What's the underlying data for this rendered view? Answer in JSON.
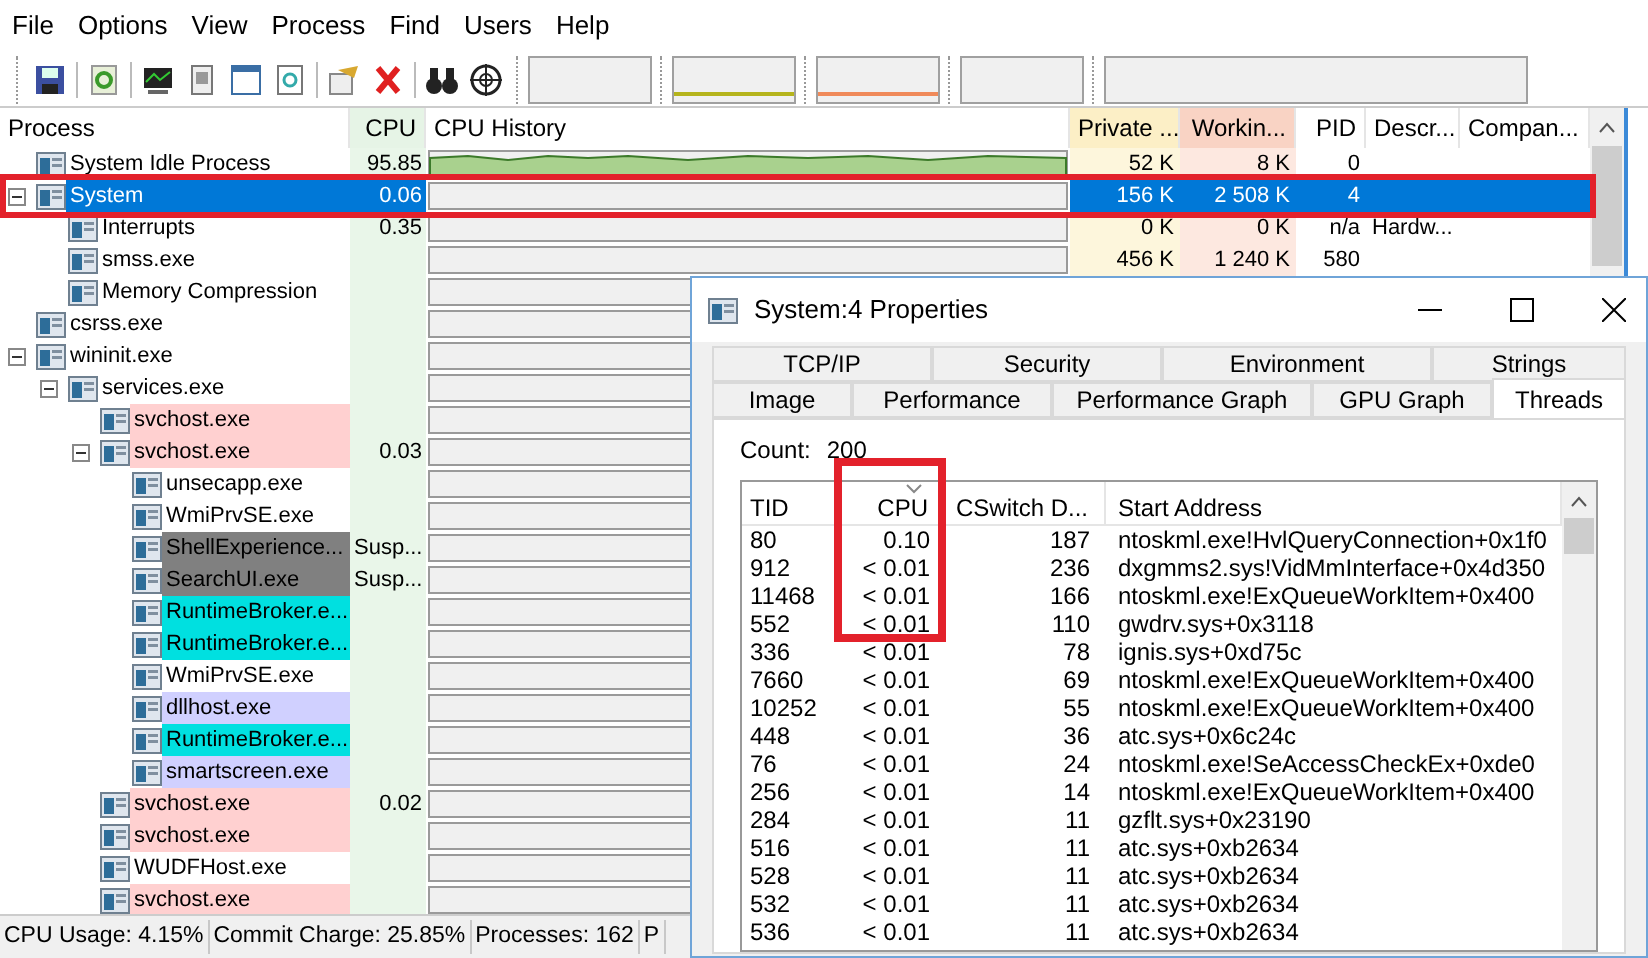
{
  "menu": [
    "File",
    "Options",
    "View",
    "Process",
    "Find",
    "Users",
    "Help"
  ],
  "columns": [
    "Process",
    "CPU",
    "CPU History",
    "Private ...",
    "Workin...",
    "PID",
    "Descr...",
    "Compan..."
  ],
  "processes": [
    {
      "name": "System Idle Process",
      "cpu": "95.85",
      "private": "52 K",
      "working": "8 K",
      "pid": "0",
      "selected": false
    },
    {
      "name": "System",
      "cpu": "0.06",
      "private": "156 K",
      "working": "2 508 K",
      "pid": "4",
      "selected": true,
      "expanded": true,
      "children": [
        {
          "name": "Interrupts",
          "cpu": "0.35",
          "private": "0 K",
          "working": "0 K",
          "pid": "n/a",
          "description": "Hardw...",
          "selected": false
        },
        {
          "name": "smss.exe",
          "private": "456 K",
          "working": "1 240 K",
          "pid": "580",
          "selected": false
        },
        {
          "name": "Memory Compression",
          "selected": false
        }
      ]
    },
    {
      "name": "csrss.exe",
      "selected": false
    },
    {
      "name": "wininit.exe",
      "selected": false,
      "expanded": true,
      "children": [
        {
          "name": "services.exe",
          "selected": false,
          "expanded": true,
          "children": [
            {
              "name": "svchost.exe",
              "color": "#ffd0d0",
              "selected": false
            },
            {
              "name": "svchost.exe",
              "cpu": "0.03",
              "color": "#ffd0d0",
              "selected": false,
              "expanded": true,
              "children": [
                {
                  "name": "unsecapp.exe",
                  "selected": false
                },
                {
                  "name": "WmiPrvSE.exe",
                  "selected": false
                },
                {
                  "name": "ShellExperience...",
                  "cpu": "Susp...",
                  "color": "#808080",
                  "selected": false
                },
                {
                  "name": "SearchUI.exe",
                  "cpu": "Susp...",
                  "color": "#808080",
                  "selected": false
                },
                {
                  "name": "RuntimeBroker.e...",
                  "color": "#00e0e0",
                  "selected": false
                },
                {
                  "name": "RuntimeBroker.e...",
                  "color": "#00e0e0",
                  "selected": false
                },
                {
                  "name": "WmiPrvSE.exe",
                  "selected": false
                },
                {
                  "name": "dllhost.exe",
                  "color": "#d0d0ff",
                  "selected": false
                },
                {
                  "name": "RuntimeBroker.e...",
                  "color": "#00e0e0",
                  "selected": false
                },
                {
                  "name": "smartscreen.exe",
                  "color": "#d0d0ff",
                  "selected": false
                }
              ]
            },
            {
              "name": "svchost.exe",
              "cpu": "0.02",
              "color": "#ffd0d0",
              "selected": false
            },
            {
              "name": "svchost.exe",
              "color": "#ffd0d0",
              "selected": false
            },
            {
              "name": "WUDFHost.exe",
              "selected": false
            },
            {
              "name": "svchost.exe",
              "color": "#ffd0d0",
              "selected": false
            }
          ]
        }
      ]
    }
  ],
  "status_bar": [
    "CPU Usage: 4.15%",
    "Commit Charge: 25.85%",
    "Processes: 162",
    "P"
  ],
  "dialog": {
    "title": "System:4 Properties",
    "tab_rows": [
      [
        {
          "label": "TCP/IP",
          "selected": false
        },
        {
          "label": "Security",
          "selected": false
        },
        {
          "label": "Environment",
          "selected": false
        },
        {
          "label": "Strings",
          "selected": false
        }
      ],
      [
        {
          "label": "Image",
          "selected": false
        },
        {
          "label": "Performance",
          "selected": false
        },
        {
          "label": "Performance Graph",
          "selected": false
        },
        {
          "label": "GPU Graph",
          "selected": false
        },
        {
          "label": "Threads",
          "selected": true
        }
      ]
    ],
    "count_label": "Count:",
    "count": "200",
    "columns": [
      {
        "label": "TID",
        "sorted": false
      },
      {
        "label": "CPU",
        "sorted": true
      },
      {
        "label": "CSwitch D...",
        "sorted": false
      },
      {
        "label": "Start Address",
        "sorted": false
      }
    ],
    "threads": [
      [
        "80",
        "0.10",
        "187",
        "ntoskml.exe!HvlQueryConnection+0x1f0"
      ],
      [
        "912",
        "< 0.01",
        "236",
        "dxgmms2.sys!VidMmInterface+0x4d350"
      ],
      [
        "11468",
        "< 0.01",
        "166",
        "ntoskml.exe!ExQueueWorkItem+0x400"
      ],
      [
        "552",
        "< 0.01",
        "110",
        "gwdrv.sys+0x3118"
      ],
      [
        "336",
        "< 0.01",
        "78",
        "ignis.sys+0xd75c"
      ],
      [
        "7660",
        "< 0.01",
        "69",
        "ntoskml.exe!ExQueueWorkItem+0x400"
      ],
      [
        "10252",
        "< 0.01",
        "55",
        "ntoskml.exe!ExQueueWorkItem+0x400"
      ],
      [
        "448",
        "< 0.01",
        "36",
        "atc.sys+0x6c24c"
      ],
      [
        "76",
        "< 0.01",
        "24",
        "ntoskml.exe!SeAccessCheckEx+0xde0"
      ],
      [
        "256",
        "< 0.01",
        "14",
        "ntoskml.exe!ExQueueWorkItem+0x400"
      ],
      [
        "284",
        "< 0.01",
        "11",
        "gzflt.sys+0x23190"
      ],
      [
        "516",
        "< 0.01",
        "11",
        "atc.sys+0xb2634"
      ],
      [
        "528",
        "< 0.01",
        "11",
        "atc.sys+0xb2634"
      ],
      [
        "532",
        "< 0.01",
        "11",
        "atc.sys+0xb2634"
      ],
      [
        "536",
        "< 0.01",
        "11",
        "atc.sys+0xb2634"
      ]
    ]
  }
}
